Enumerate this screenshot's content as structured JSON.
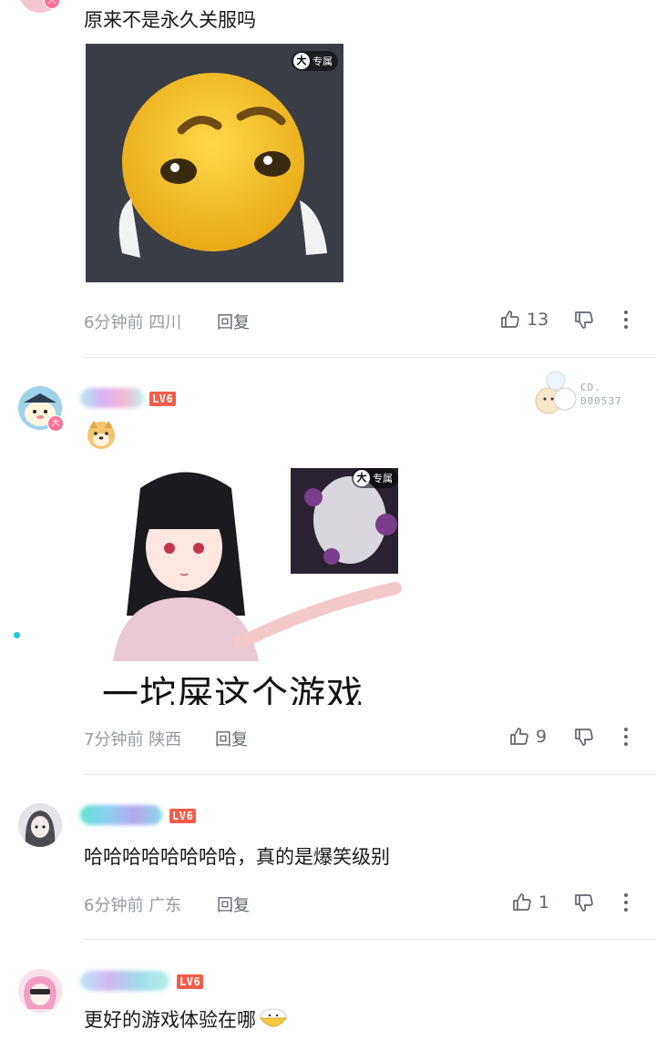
{
  "comments": [
    {
      "text": "原来不是永久关服吗",
      "time": "6分钟前",
      "location": "四川",
      "reply_label": "回复",
      "likes": "13",
      "sticker_tag": "专属"
    },
    {
      "level": "LV6",
      "fan_badge_text": "CD.",
      "fan_badge_num": "000537",
      "meme_caption": "一坨屎这个游戏",
      "meme_tag": "专属",
      "time": "7分钟前",
      "location": "陕西",
      "reply_label": "回复",
      "likes": "9"
    },
    {
      "level": "LV6",
      "text": "哈哈哈哈哈哈哈哈，真的是爆笑级别",
      "time": "6分钟前",
      "location": "广东",
      "reply_label": "回复",
      "likes": "1"
    },
    {
      "level": "LV6",
      "text": "更好的游戏体验在哪"
    }
  ],
  "vip_badge": "大",
  "icons": [
    "thumb-up-icon",
    "thumb-down-icon",
    "more-icon"
  ],
  "colors": {
    "accent": "#fb7299",
    "level": "#f25d4a",
    "meta": "#9499a0"
  }
}
